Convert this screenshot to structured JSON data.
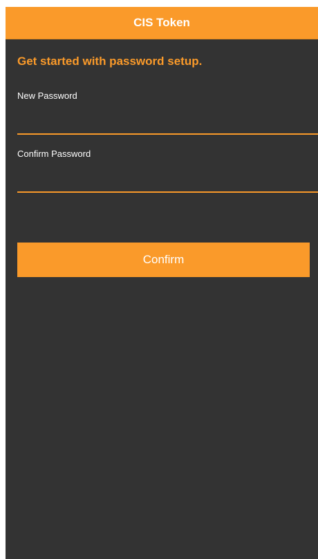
{
  "nav": {
    "title": "CIS Token"
  },
  "form": {
    "heading": "Get started with password setup.",
    "new_password": {
      "label": "New Password",
      "value": "",
      "placeholder": ""
    },
    "confirm_password": {
      "label": "Confirm Password",
      "value": "",
      "placeholder": ""
    },
    "confirm_label": "Confirm"
  },
  "colors": {
    "accent": "#fa9a2a",
    "background": "#333333",
    "text": "#ffffff"
  }
}
